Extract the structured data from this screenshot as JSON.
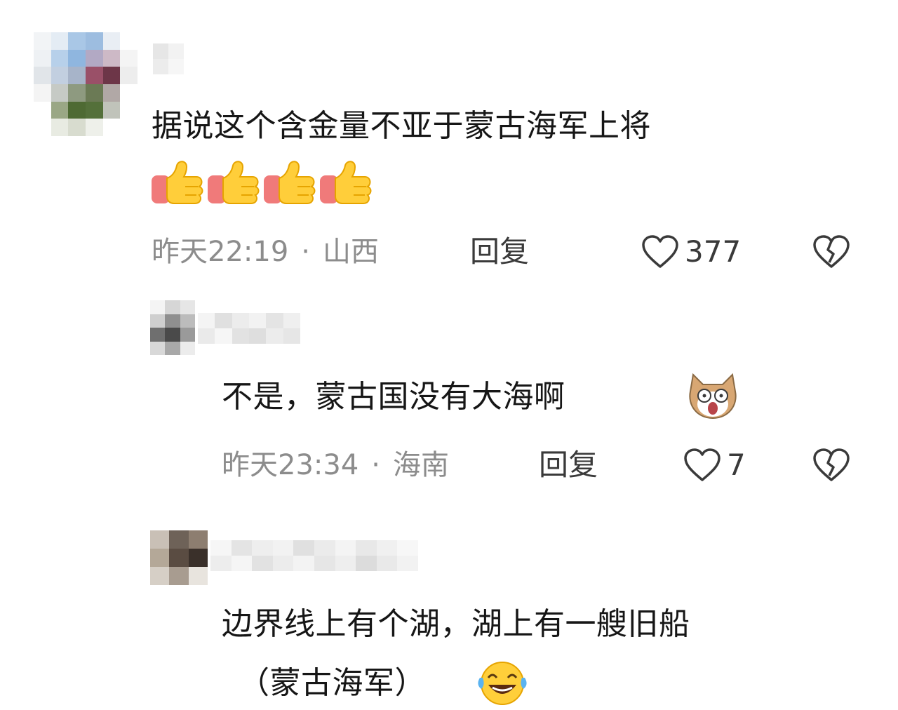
{
  "comments": [
    {
      "text_line_1": "据说这个含金量不亚于蒙古海军上将",
      "emoji": "thumbs-up x4",
      "time": "昨天22:19",
      "dot": "·",
      "location": "山西",
      "reply_label": "回复",
      "likes": "377"
    },
    {
      "text_line_1": "不是，蒙古国没有大海啊",
      "emoji": "shocked-dog",
      "time": "昨天23:34",
      "dot": "·",
      "location": "海南",
      "reply_label": "回复",
      "likes": "7"
    },
    {
      "text_line_1": "边界线上有个湖，湖上有一艘旧船",
      "text_line_2": "（蒙古海军）",
      "emoji": "laughing-tears"
    }
  ],
  "colors": {
    "meta_gray": "#8c8c8c",
    "text": "#161616",
    "icon": "#3a3a3a"
  }
}
